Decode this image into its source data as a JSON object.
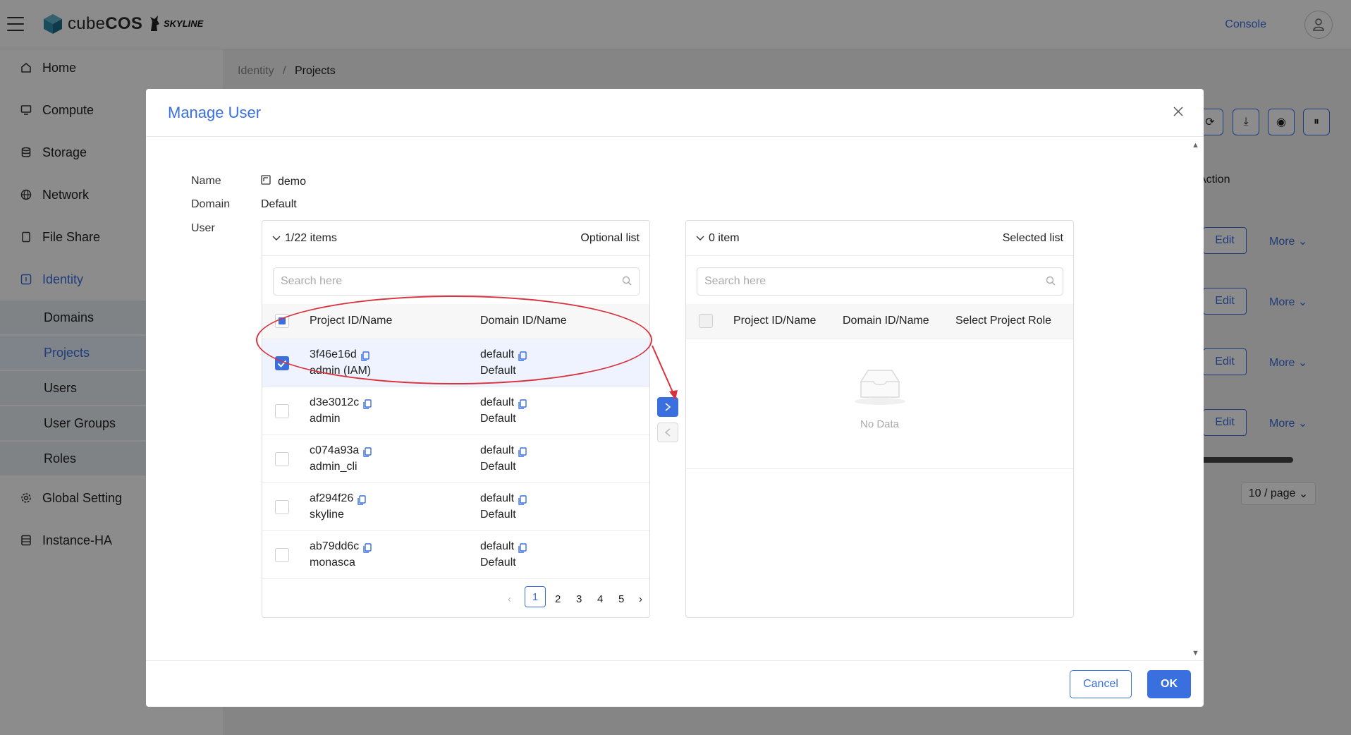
{
  "app": {
    "brand_name_light": "cube",
    "brand_name_bold": "COS",
    "partner_logo": "SKYLINE",
    "console_label": "Console"
  },
  "sidebar": {
    "items": [
      {
        "label": "Home",
        "icon": "home-icon"
      },
      {
        "label": "Compute",
        "icon": "monitor-icon"
      },
      {
        "label": "Storage",
        "icon": "database-icon"
      },
      {
        "label": "Network",
        "icon": "globe-icon"
      },
      {
        "label": "File Share",
        "icon": "file-icon"
      },
      {
        "label": "Identity",
        "icon": "identity-icon"
      },
      {
        "label": "Global Setting",
        "icon": "gear-icon"
      },
      {
        "label": "Instance-HA",
        "icon": "server-icon"
      }
    ],
    "identity_sub": [
      "Domains",
      "Projects",
      "Users",
      "User Groups",
      "Roles"
    ],
    "active_item": "Identity",
    "active_sub": "Projects"
  },
  "breadcrumb": {
    "parent": "Identity",
    "separator": "/",
    "current": "Projects"
  },
  "background_table": {
    "action_header": "Action",
    "edit_label": "Edit",
    "more_label": "More",
    "page_size": "10 / page"
  },
  "modal": {
    "title": "Manage User",
    "name_label": "Name",
    "name_value": "demo",
    "domain_label": "Domain",
    "domain_value": "Default",
    "user_label": "User",
    "cancel_label": "Cancel",
    "ok_label": "OK",
    "left": {
      "count": "1/22 items",
      "kind": "Optional list",
      "search_placeholder": "Search here",
      "col_project": "Project ID/Name",
      "col_domain": "Domain ID/Name",
      "rows": [
        {
          "id": "3f46e16d",
          "name": "admin (IAM)",
          "domain_id": "default",
          "domain_name": "Default",
          "checked": true
        },
        {
          "id": "d3e3012c",
          "name": "admin",
          "domain_id": "default",
          "domain_name": "Default",
          "checked": false
        },
        {
          "id": "c074a93a",
          "name": "admin_cli",
          "domain_id": "default",
          "domain_name": "Default",
          "checked": false
        },
        {
          "id": "af294f26",
          "name": "skyline",
          "domain_id": "default",
          "domain_name": "Default",
          "checked": false
        },
        {
          "id": "ab79dd6c",
          "name": "monasca",
          "domain_id": "default",
          "domain_name": "Default",
          "checked": false
        }
      ],
      "pages": [
        "1",
        "2",
        "3",
        "4",
        "5"
      ],
      "current_page": "1"
    },
    "right": {
      "count": "0 item",
      "kind": "Selected list",
      "search_placeholder": "Search here",
      "col_project": "Project ID/Name",
      "col_domain": "Domain ID/Name",
      "col_role": "Select Project Role",
      "empty_text": "No Data"
    }
  },
  "colors": {
    "accent": "#3a6fe0",
    "annotation": "#d9323c"
  }
}
